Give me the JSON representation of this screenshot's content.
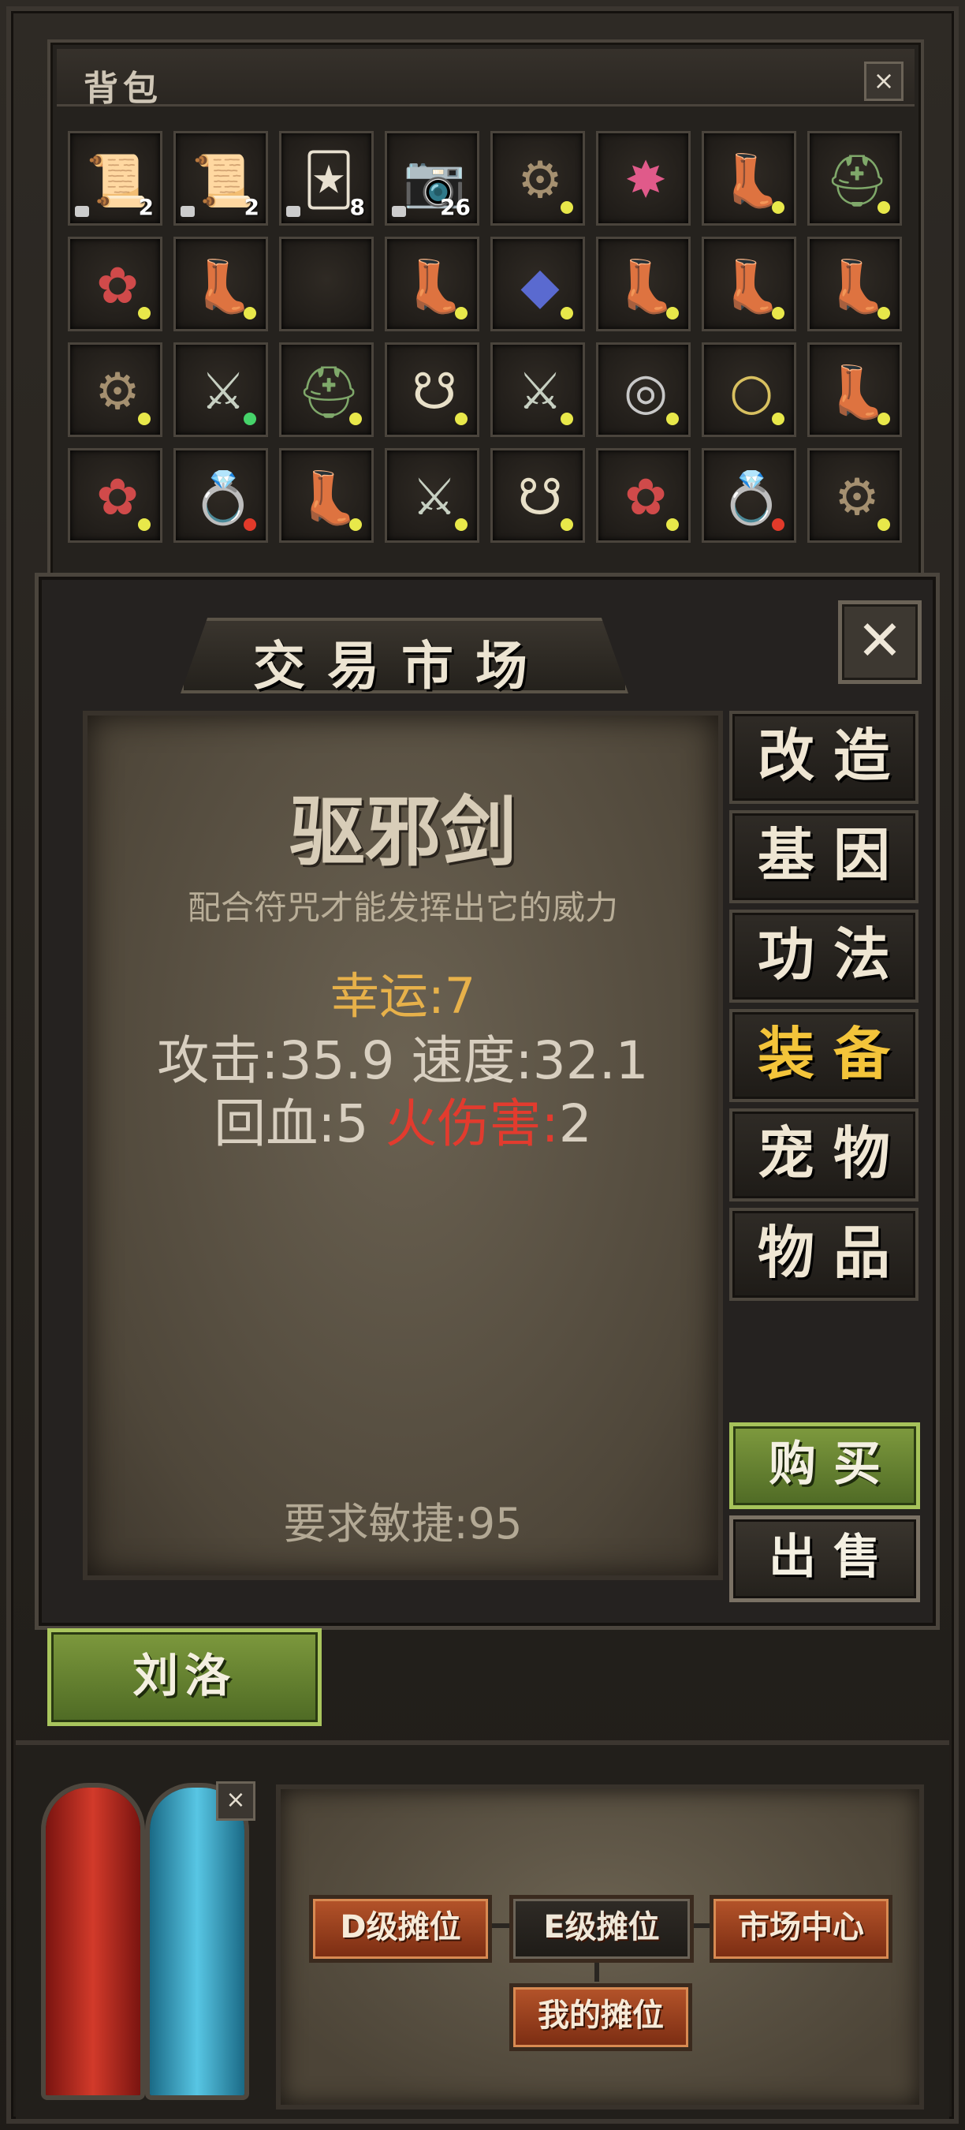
{
  "backpack": {
    "title": "背包",
    "close_label": "×",
    "slots": [
      {
        "icon": "scroll-icon",
        "qty": "2",
        "locked": true,
        "dot": ""
      },
      {
        "icon": "scroll-green-icon",
        "qty": "2",
        "locked": true,
        "dot": ""
      },
      {
        "icon": "recipe-card-icon",
        "qty": "8",
        "locked": true,
        "dot": ""
      },
      {
        "icon": "camera-icon",
        "qty": "26",
        "locked": true,
        "dot": ""
      },
      {
        "icon": "belt-icon",
        "qty": "",
        "locked": false,
        "dot": "yellow"
      },
      {
        "icon": "gem-necklace-icon",
        "qty": "",
        "locked": false,
        "dot": ""
      },
      {
        "icon": "boots-icon",
        "qty": "",
        "locked": false,
        "dot": "yellow"
      },
      {
        "icon": "helmet-icon",
        "qty": "",
        "locked": false,
        "dot": "yellow"
      },
      {
        "icon": "flower-bracer-icon",
        "qty": "",
        "locked": false,
        "dot": "yellow"
      },
      {
        "icon": "boots-icon",
        "qty": "",
        "locked": false,
        "dot": "yellow"
      },
      {
        "icon": "empty-slot",
        "qty": "",
        "locked": false,
        "dot": ""
      },
      {
        "icon": "boots-icon",
        "qty": "",
        "locked": false,
        "dot": "yellow"
      },
      {
        "icon": "amulet-icon",
        "qty": "",
        "locked": false,
        "dot": "yellow"
      },
      {
        "icon": "boots-icon",
        "qty": "",
        "locked": false,
        "dot": "yellow"
      },
      {
        "icon": "boots-icon",
        "qty": "",
        "locked": false,
        "dot": "yellow"
      },
      {
        "icon": "boots-icon",
        "qty": "",
        "locked": false,
        "dot": "yellow"
      },
      {
        "icon": "belt-icon",
        "qty": "",
        "locked": false,
        "dot": "yellow"
      },
      {
        "icon": "sword-icon",
        "qty": "",
        "locked": false,
        "dot": "green"
      },
      {
        "icon": "helmet-icon",
        "qty": "",
        "locked": false,
        "dot": "yellow"
      },
      {
        "icon": "bone-necklace-icon",
        "qty": "",
        "locked": false,
        "dot": "yellow"
      },
      {
        "icon": "sword-icon",
        "qty": "",
        "locked": false,
        "dot": "yellow"
      },
      {
        "icon": "bracelet-icon",
        "qty": "",
        "locked": false,
        "dot": "yellow"
      },
      {
        "icon": "bead-necklace-icon",
        "qty": "",
        "locked": false,
        "dot": "yellow"
      },
      {
        "icon": "boots-icon",
        "qty": "",
        "locked": false,
        "dot": "yellow"
      },
      {
        "icon": "flower-bracer-icon",
        "qty": "",
        "locked": false,
        "dot": "yellow"
      },
      {
        "icon": "ring-icon",
        "qty": "",
        "locked": false,
        "dot": "red"
      },
      {
        "icon": "boots-icon",
        "qty": "",
        "locked": false,
        "dot": "yellow"
      },
      {
        "icon": "sword-icon",
        "qty": "",
        "locked": false,
        "dot": "yellow"
      },
      {
        "icon": "bone-necklace-icon",
        "qty": "",
        "locked": false,
        "dot": "yellow"
      },
      {
        "icon": "flower-bracer-icon",
        "qty": "",
        "locked": false,
        "dot": "yellow"
      },
      {
        "icon": "ring-icon",
        "qty": "",
        "locked": false,
        "dot": "red"
      },
      {
        "icon": "belt-icon",
        "qty": "",
        "locked": false,
        "dot": "yellow"
      }
    ]
  },
  "market": {
    "title": "交易市场",
    "close_label": "✕",
    "item": {
      "name": "驱邪剑",
      "description": "配合符咒才能发挥出它的威力",
      "luck": "幸运:7",
      "attack": "攻击:35.9",
      "speed": "速度:32.1",
      "regen": "回血:5",
      "fire_label": "火伤害:",
      "fire_value": "2",
      "requirement": "要求敏捷:95"
    },
    "tabs": [
      {
        "label": "改造",
        "active": false
      },
      {
        "label": "基因",
        "active": false
      },
      {
        "label": "功法",
        "active": false
      },
      {
        "label": "装备",
        "active": true
      },
      {
        "label": "宠物",
        "active": false
      },
      {
        "label": "物品",
        "active": false
      }
    ],
    "buy_label": "购买",
    "sell_label": "出售",
    "player_name": "刘洛"
  },
  "hud": {
    "close_label": "×",
    "hp_fill": 1.0,
    "mp_fill": 1.0,
    "stall_buttons": {
      "d_level": "D级摊位",
      "e_level": "E级摊位",
      "market_center": "市场中心",
      "my_stall": "我的摊位"
    }
  },
  "colors": {
    "accent_gold": "#f3c43a",
    "luck_orange": "#e7b14a",
    "fire_red": "#e23b2e",
    "buy_green": "#7e9a3e"
  }
}
